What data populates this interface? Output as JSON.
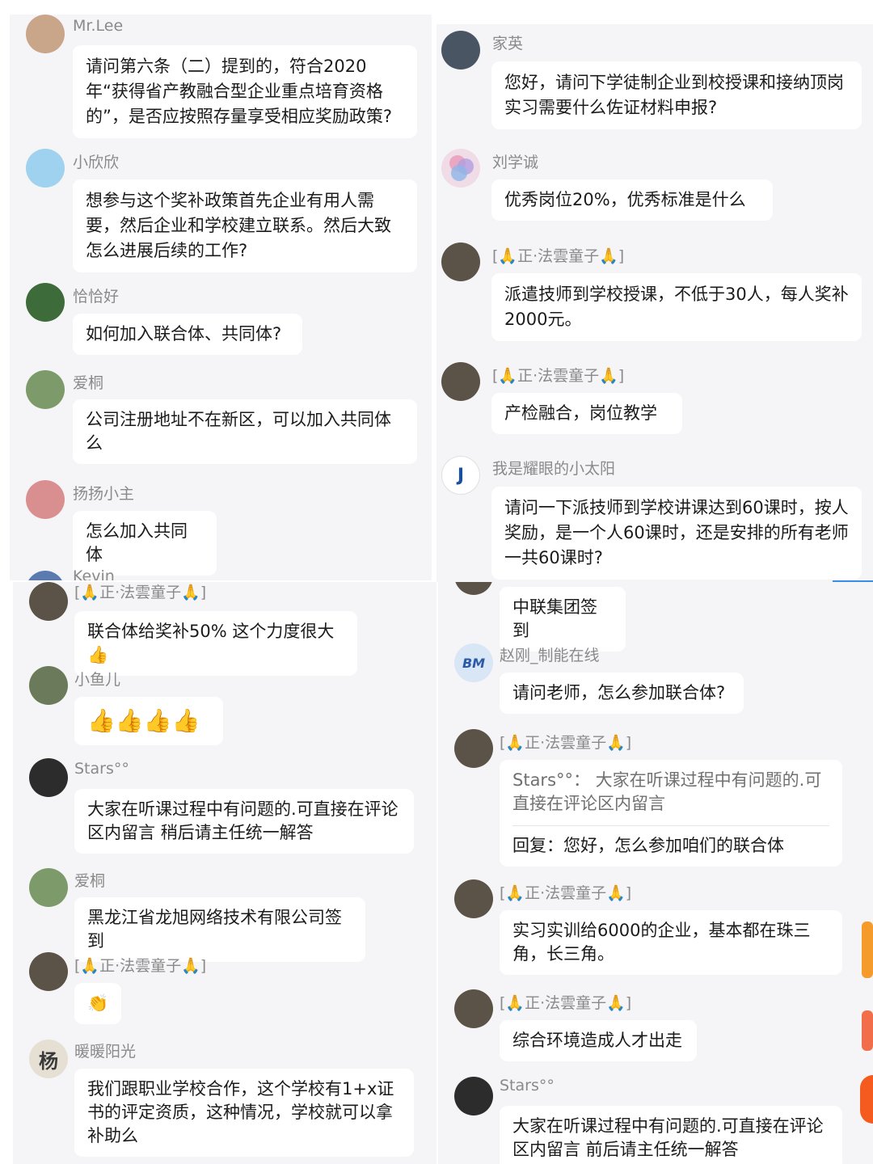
{
  "tl": [
    {
      "name": "Mr.Lee",
      "text": "请问第六条（二）提到的，符合2020年“获得省产教融合型企业重点培育资格的”，是否应按照存量享受相应奖励政策?"
    },
    {
      "name": "小欣欣",
      "text": "想参与这个奖补政策首先企业有用人需要，然后企业和学校建立联系。然后大致怎么进展后续的工作?"
    },
    {
      "name": "恰恰好",
      "text": "如何加入联合体、共同体?"
    },
    {
      "name": "爱桐",
      "text": "公司注册地址不在新区，可以加入共同体么"
    },
    {
      "name": "扬扬小主",
      "text": "怎么加入共同体"
    },
    {
      "name": "Kevin",
      "text": ""
    }
  ],
  "tr": [
    {
      "name": "家英",
      "text": "您好，请问下学徒制企业到校授课和接纳顶岗实习需要什么佐证材料申报?"
    },
    {
      "name": "刘学诚",
      "text": "优秀岗位20%，优秀标准是什么"
    },
    {
      "name": "[🙏正·法雲童子🙏]",
      "text": "派遣技师到学校授课，不低于30人，每人奖补2000元。"
    },
    {
      "name": "[🙏正·法雲童子🙏]",
      "text": "产检融合，岗位教学"
    },
    {
      "name": "我是耀眼的小太阳",
      "text": "请问一下派技师到学校讲课达到60课时，按人奖励，是一个人60课时，还是安排的所有老师一共60课时?"
    }
  ],
  "bl": [
    {
      "name": "[🙏正·法雲童子🙏]",
      "text": "联合体给奖补50% 这个力度很大👍"
    },
    {
      "name": "小鱼儿",
      "text": "👍👍👍👍"
    },
    {
      "name": "Stars°°",
      "text": "大家在听课过程中有问题的.可直接在评论区内留言 稍后请主任统一解答"
    },
    {
      "name": "爱桐",
      "text": "黑龙江省龙旭网络技术有限公司签到"
    },
    {
      "name": "[🙏正·法雲童子🙏]",
      "text": "👏"
    },
    {
      "name": "暖暖阳光",
      "text": "我们跟职业学校合作，这个学校有1+x证书的评定资质，这种情况，学校就可以拿补助么"
    }
  ],
  "br": [
    {
      "name": "",
      "text": "中联集团签到"
    },
    {
      "name": "赵刚_制能在线",
      "text": "请问老师，怎么参加联合体?"
    },
    {
      "name": "[🙏正·法雲童子🙏]",
      "quote": "Stars°°：  大家在听课过程中有问题的.可直接在评论区内留言",
      "reply": "回复：您好，怎么参加咱们的联合体"
    },
    {
      "name": "[🙏正·法雲童子🙏]",
      "text": "实习实训给6000的企业，基本都在珠三角，长三角。"
    },
    {
      "name": "[🙏正·法雲童子🙏]",
      "text": "综合环境造成人才出走"
    },
    {
      "name": "Stars°°",
      "text": "大家在听课过程中有问题的.可直接在评论区内留言 前后请主任统一解答"
    }
  ],
  "avatar_glyphs": {
    "yang": "杨"
  },
  "colors": {
    "panel_bg": "#f5f5f7",
    "bubble_bg": "#ffffff",
    "name_gray": "#8a8a8a",
    "accent_blue": "#3b8de6"
  }
}
